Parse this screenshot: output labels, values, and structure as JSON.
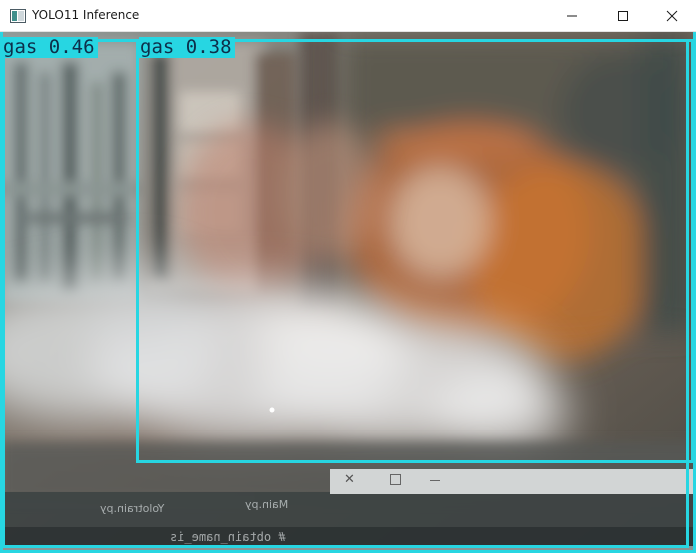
{
  "window": {
    "title": "YOLO11 Inference",
    "controls": [
      "minimize",
      "maximize",
      "close"
    ]
  },
  "detections": [
    {
      "class": "gas",
      "confidence": "0.46",
      "label": "gas 0.46"
    },
    {
      "class": "gas",
      "confidence": "0.38",
      "label": "gas 0.38"
    }
  ],
  "background_editor": {
    "tabs": [
      "Yolotrain.py",
      "Main.py"
    ],
    "code_snippet": "# obtain_name_is"
  },
  "colors": {
    "box": "#27d6e2",
    "label_text": "#0d2f4a",
    "titlebar": "#ffffff"
  }
}
